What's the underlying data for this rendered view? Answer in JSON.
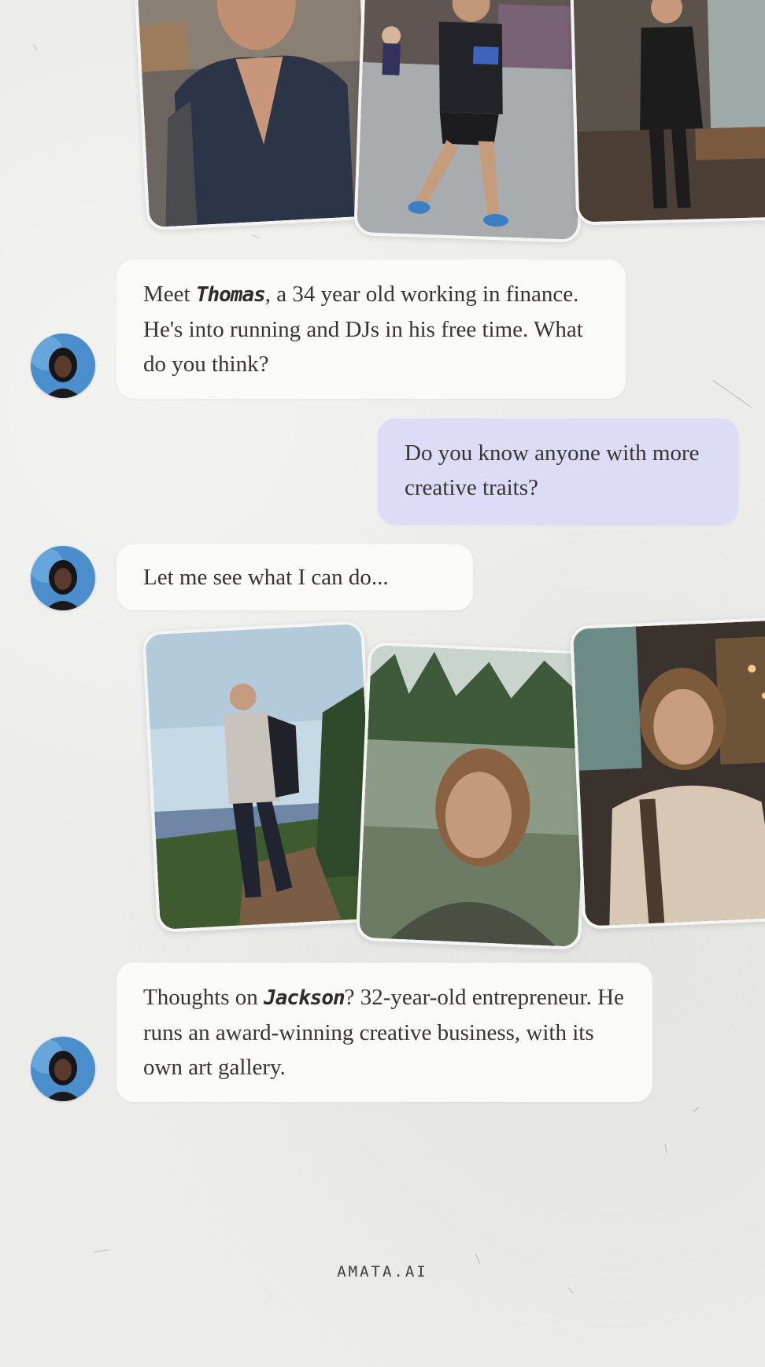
{
  "messages": {
    "thomas": {
      "pre": "Meet ",
      "name": "Thomas",
      "post": ", a 34 year old working in finance. He's into running and DJs in his free time. What do you think?"
    },
    "user_reply": "Do you know anyone with more creative traits?",
    "assistant_wait": "Let me see what I can do...",
    "jackson": {
      "pre": "Thoughts on ",
      "name": "Jackson",
      "post": "? 32-year-old entrepreneur. He runs an award-winning creative business, with its own art gallery."
    }
  },
  "footer": {
    "brand": "AMATA.AI"
  },
  "colors": {
    "background": "#ececea",
    "assistant_bubble": "#fafaf9",
    "user_bubble": "#dcdcf6",
    "text": "#3a3430"
  },
  "icons": {
    "avatar": "assistant-avatar"
  }
}
